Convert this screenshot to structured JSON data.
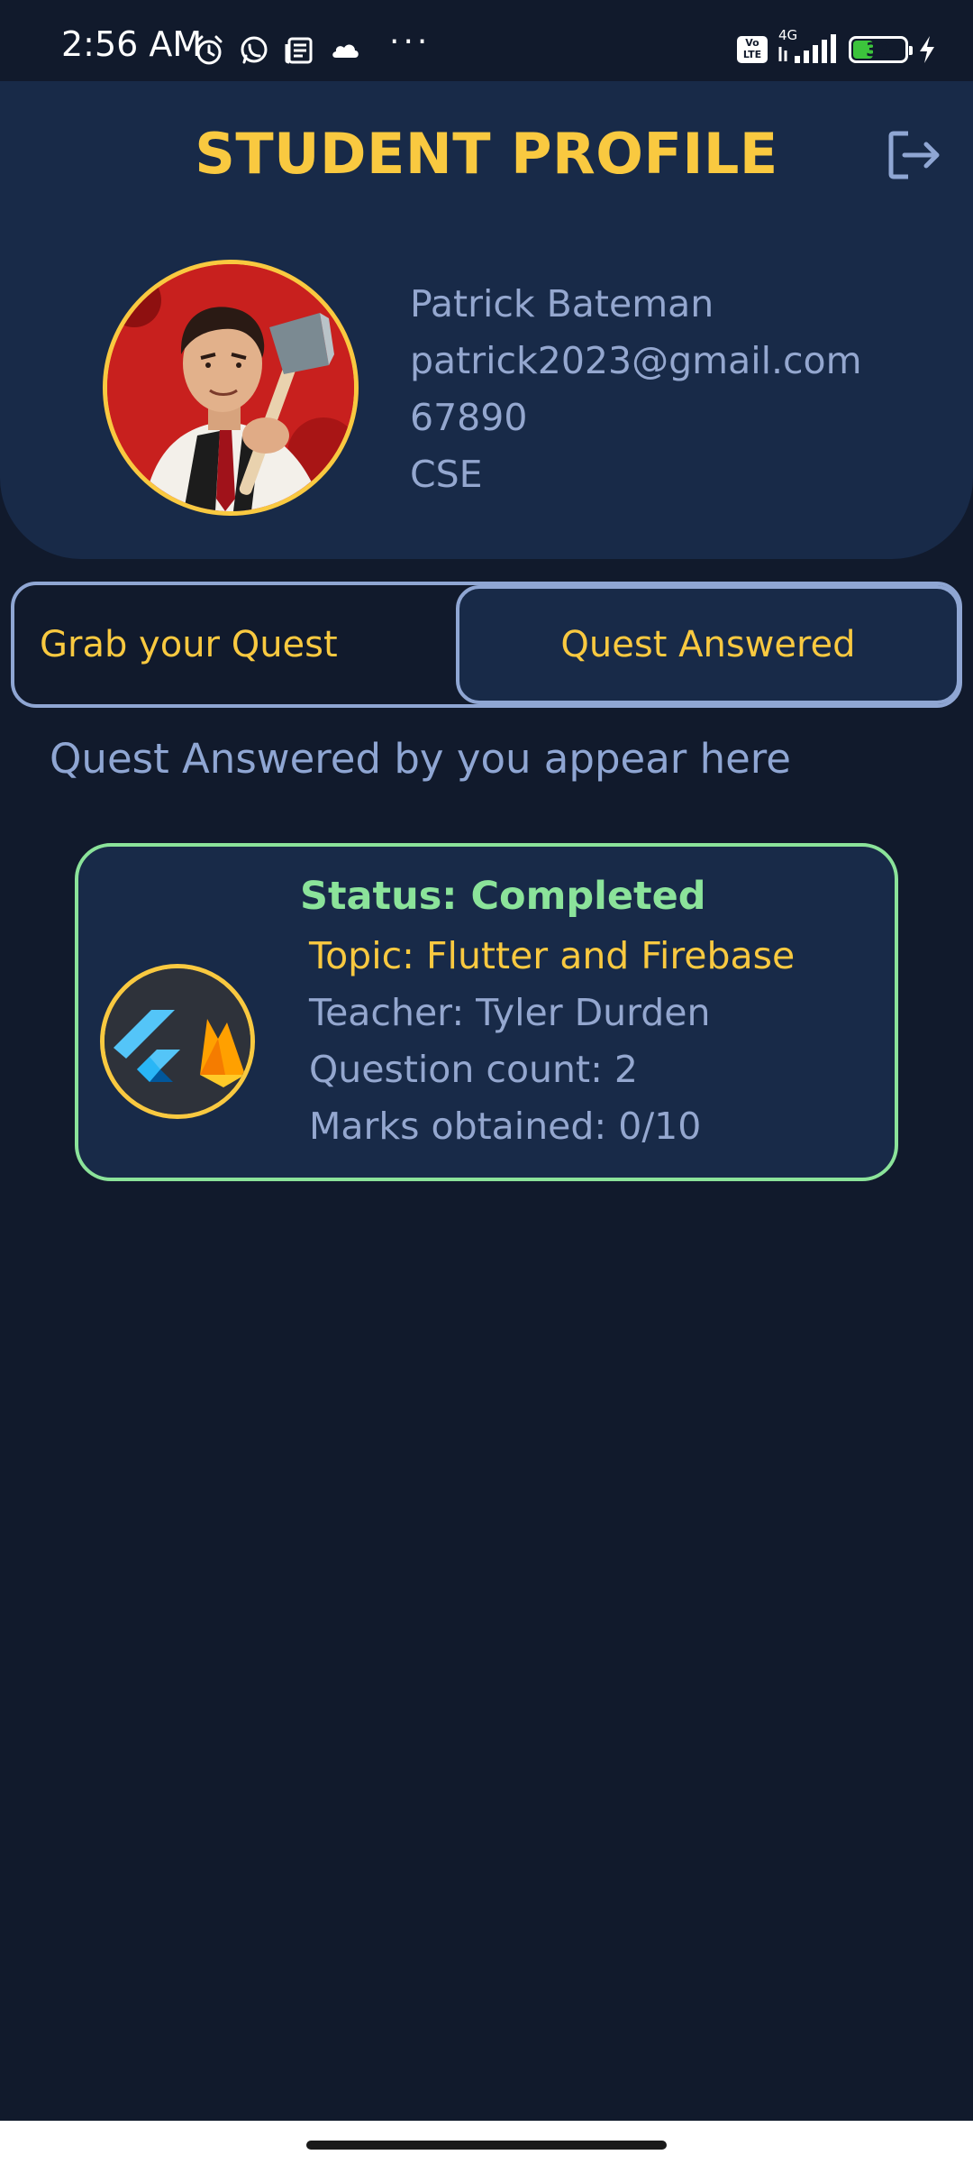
{
  "status_bar": {
    "time": "2:56 AM",
    "dots": "···",
    "volte": "Vo LTE",
    "network": "4G",
    "battery": "39",
    "battery_level": 0.39
  },
  "header": {
    "title": "STUDENT PROFILE",
    "logout_icon": "logout-icon"
  },
  "profile": {
    "name": "Patrick Bateman",
    "email": "patrick2023@gmail.com",
    "id": "67890",
    "department": "CSE"
  },
  "tabs": [
    {
      "label": "Grab your Quest",
      "selected": false
    },
    {
      "label": "Quest Answered",
      "selected": true
    }
  ],
  "caption": "Quest Answered by you appear here",
  "quests": [
    {
      "status": "Status: Completed",
      "topic": "Topic: Flutter and Firebase",
      "teacher": "Teacher: Tyler Durden",
      "question_count": "Question count: 2",
      "marks": "Marks obtained: 0/10",
      "logo_icon": "flutter-firebase-logo"
    }
  ],
  "colors": {
    "background": "#111a2c",
    "panel": "#182a48",
    "accent": "#f9c940",
    "text": "#94a7cf",
    "success": "#8be39a",
    "border": "#8fa6d3"
  }
}
